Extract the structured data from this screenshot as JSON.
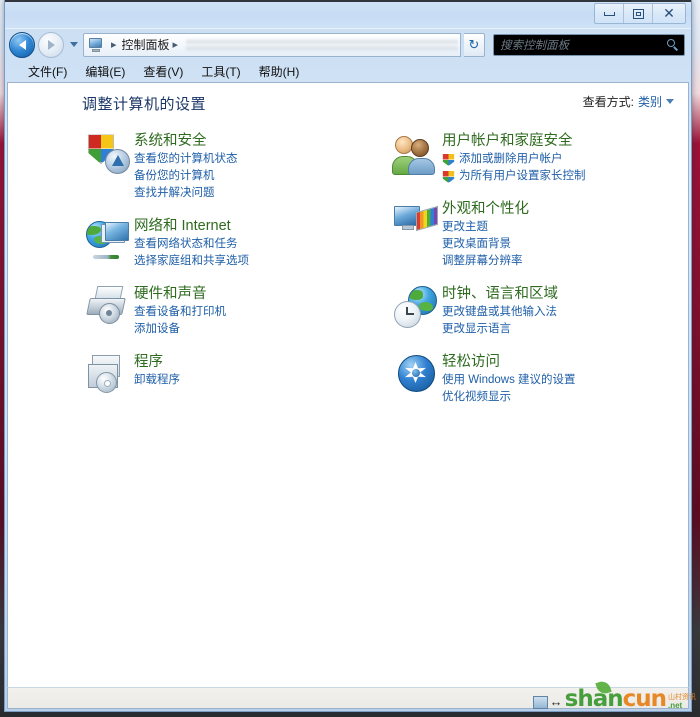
{
  "window": {
    "controls": {
      "minimize_label": "最小化",
      "restore_label": "还原",
      "close_label": "关闭",
      "close_glyph": "✕"
    }
  },
  "addressbar": {
    "back_label": "后退",
    "forward_label": "前进",
    "recent_label": "最近浏览的位置",
    "computer_icon": "computer-icon",
    "crumb": "控制面板",
    "separator": "▸",
    "refresh_glyph": "↻",
    "refresh_label": "刷新"
  },
  "search": {
    "placeholder": "搜索控制面板",
    "icon": "search-icon"
  },
  "menubar": {
    "items": [
      {
        "label": "文件(F)"
      },
      {
        "label": "编辑(E)"
      },
      {
        "label": "查看(V)"
      },
      {
        "label": "工具(T)"
      },
      {
        "label": "帮助(H)"
      }
    ]
  },
  "content": {
    "page_title": "调整计算机的设置",
    "view_by": {
      "label": "查看方式:",
      "value": "类别",
      "chevron": "chevron-down-icon"
    }
  },
  "categories": {
    "left": [
      {
        "icon": "security-shield-icon",
        "title": "系统和安全",
        "links": [
          {
            "text": "查看您的计算机状态",
            "shield": false
          },
          {
            "text": "备份您的计算机",
            "shield": false
          },
          {
            "text": "查找并解决问题",
            "shield": false
          }
        ]
      },
      {
        "icon": "network-globe-icon",
        "title": "网络和 Internet",
        "links": [
          {
            "text": "查看网络状态和任务",
            "shield": false
          },
          {
            "text": "选择家庭组和共享选项",
            "shield": false
          }
        ]
      },
      {
        "icon": "printer-icon",
        "title": "硬件和声音",
        "links": [
          {
            "text": "查看设备和打印机",
            "shield": false
          },
          {
            "text": "添加设备",
            "shield": false
          }
        ]
      },
      {
        "icon": "programs-cd-icon",
        "title": "程序",
        "links": [
          {
            "text": "卸载程序",
            "shield": false
          }
        ]
      }
    ],
    "right": [
      {
        "icon": "users-icon",
        "title": "用户帐户和家庭安全",
        "links": [
          {
            "text": "添加或删除用户帐户",
            "shield": true
          },
          {
            "text": "为所有用户设置家长控制",
            "shield": true
          }
        ]
      },
      {
        "icon": "appearance-monitor-icon",
        "title": "外观和个性化",
        "links": [
          {
            "text": "更改主题",
            "shield": false
          },
          {
            "text": "更改桌面背景",
            "shield": false
          },
          {
            "text": "调整屏幕分辨率",
            "shield": false
          }
        ]
      },
      {
        "icon": "clock-globe-icon",
        "title": "时钟、语言和区域",
        "links": [
          {
            "text": "更改键盘或其他输入法",
            "shield": false
          },
          {
            "text": "更改显示语言",
            "shield": false
          }
        ]
      },
      {
        "icon": "ease-of-access-icon",
        "title": "轻松访问",
        "links": [
          {
            "text": "使用 Windows 建议的设置",
            "shield": false
          },
          {
            "text": "优化视频显示",
            "shield": false
          }
        ]
      }
    ]
  },
  "statusbar": {
    "text": ""
  },
  "watermark": {
    "part1": "shan",
    "part2": "cun",
    "suffix_top": "山村资讯",
    "suffix_bottom": ".net"
  },
  "colors": {
    "category_title": "#2e6b1f",
    "link": "#1f5fa8",
    "page_title": "#1a3666",
    "desktop": "#7e0f2c",
    "search_background": "#000000"
  }
}
